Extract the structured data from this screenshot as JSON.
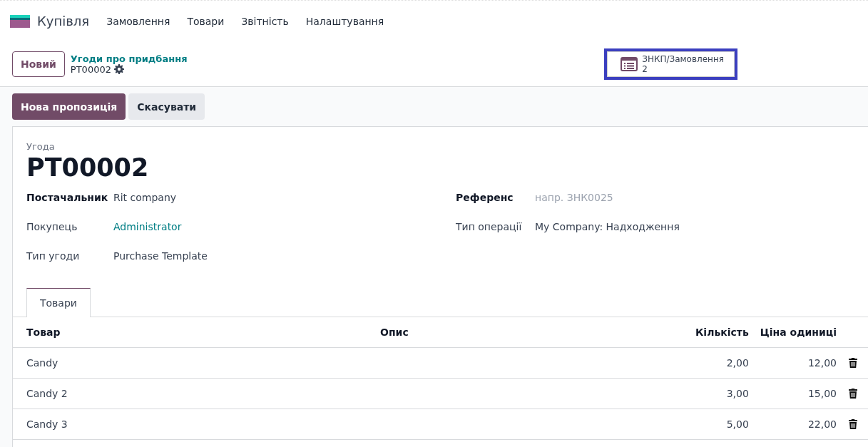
{
  "navbar": {
    "app_name": "Купівля",
    "menu": [
      "Замовлення",
      "Товари",
      "Звітність",
      "Налаштування"
    ]
  },
  "control_panel": {
    "new_button": "Новий",
    "breadcrumb": "Угоди про придбання",
    "record": "PT00002",
    "smart_button": {
      "label": "ЗНКП/Замовлення",
      "count": "2",
      "highlighted": true
    }
  },
  "actions": [
    {
      "label": "Нова пропозиція",
      "kind": "primary"
    },
    {
      "label": "Скасувати",
      "kind": "secondary"
    }
  ],
  "form": {
    "caption": "Угода",
    "name": "PT00002",
    "left_fields": [
      {
        "label": "Постачальник",
        "value": "Rit company",
        "kind": "text",
        "label_strong": true
      },
      {
        "label": "Покупець",
        "value": "Administrator",
        "kind": "link",
        "label_strong": false
      },
      {
        "label": "Тип угоди",
        "value": "Purchase Template",
        "kind": "text",
        "label_strong": false
      }
    ],
    "right_fields": [
      {
        "label": "Референс",
        "placeholder": "напр. ЗНК0025",
        "kind": "input",
        "label_strong": true
      },
      {
        "label": "Тип операції",
        "value": "My Company: Надходження",
        "kind": "text",
        "label_strong": false
      }
    ],
    "tabs": [
      {
        "label": "Товари",
        "selected": true
      }
    ],
    "table": {
      "columns": [
        "Товар",
        "Опис",
        "Кількість",
        "Ціна одиниці"
      ],
      "rows": [
        {
          "product": "Candy",
          "quantity": "2,00",
          "price": "12,00"
        },
        {
          "product": "Candy 2",
          "quantity": "3,00",
          "price": "15,00"
        },
        {
          "product": "Candy 3",
          "quantity": "5,00",
          "price": "22,00"
        }
      ]
    }
  }
}
